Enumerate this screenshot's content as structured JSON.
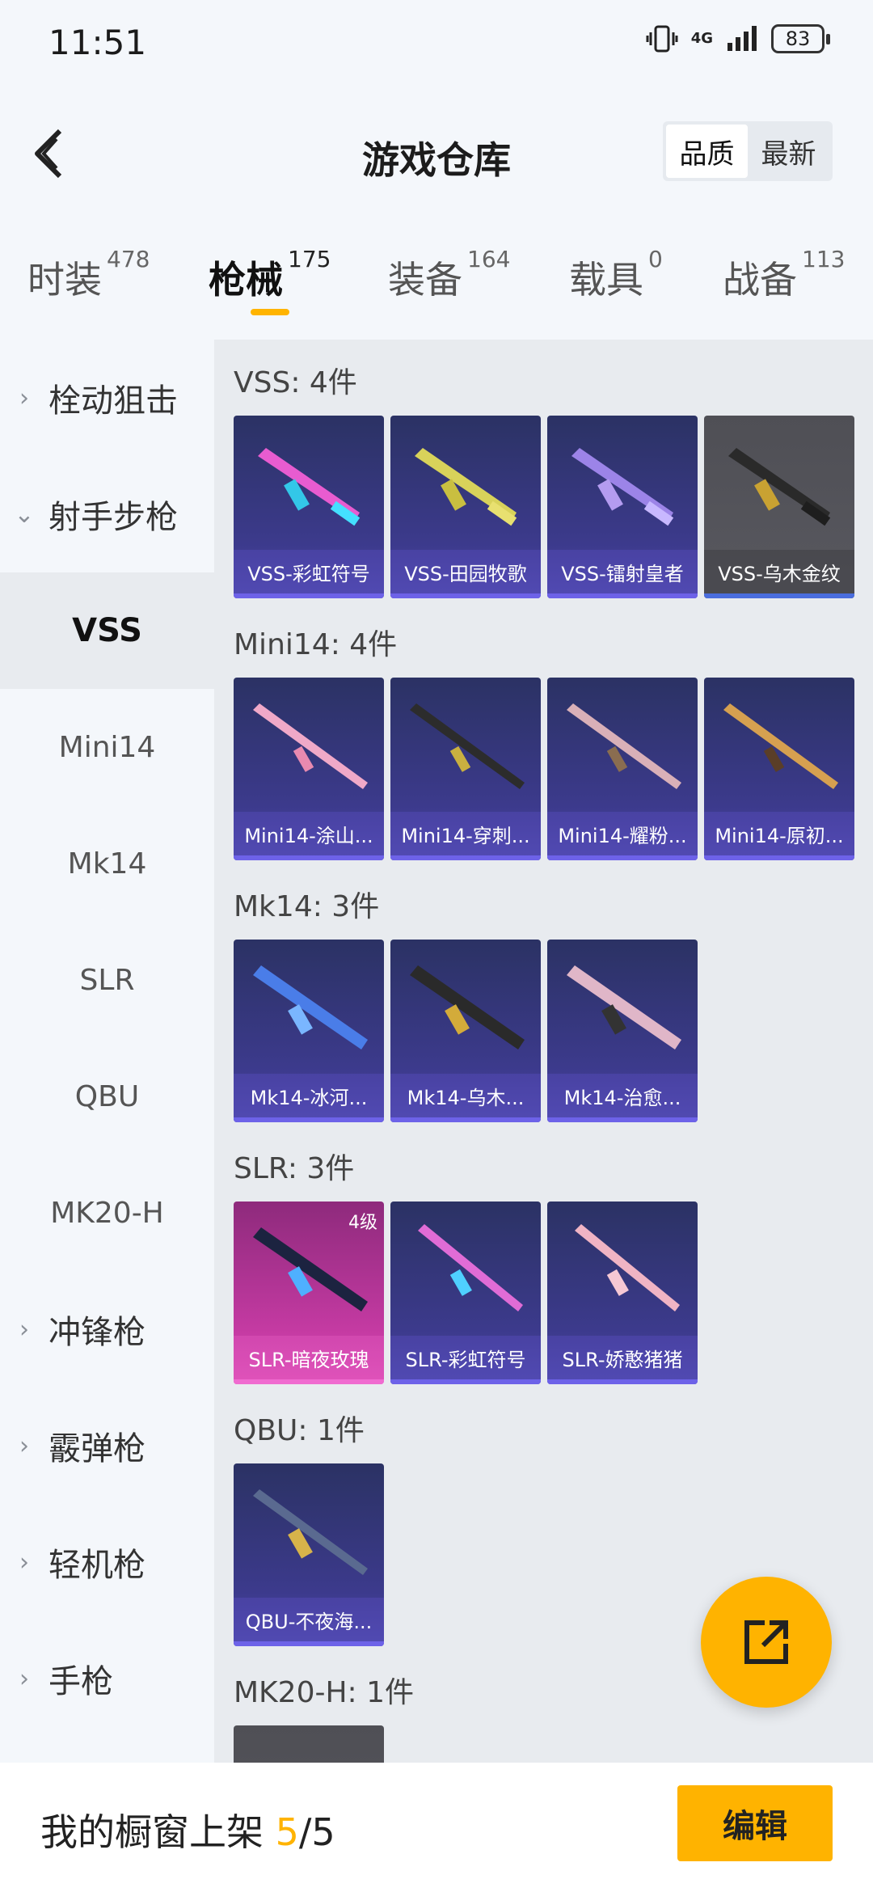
{
  "status_bar": {
    "time": "11:51",
    "network": "4G",
    "battery": "83"
  },
  "header": {
    "title": "游戏仓库",
    "sort": [
      "品质",
      "最新"
    ]
  },
  "tabs": [
    {
      "label": "时装",
      "count": "478"
    },
    {
      "label": "枪械",
      "count": "175"
    },
    {
      "label": "装备",
      "count": "164"
    },
    {
      "label": "载具",
      "count": "0"
    },
    {
      "label": "战备",
      "count": "113"
    }
  ],
  "sidebar": {
    "categories": [
      {
        "label": "栓动狙击"
      },
      {
        "label": "射手步枪"
      },
      {
        "label": "冲锋枪"
      },
      {
        "label": "霰弹枪"
      },
      {
        "label": "轻机枪"
      },
      {
        "label": "手枪"
      }
    ],
    "sub_items": [
      "VSS",
      "Mini14",
      "Mk14",
      "SLR",
      "QBU",
      "MK20-H"
    ]
  },
  "sections": [
    {
      "title": "VSS: 4件",
      "items": [
        "VSS-彩虹符号",
        "VSS-田园牧歌",
        "VSS-镭射皇者",
        "VSS-乌木金纹"
      ]
    },
    {
      "title": "Mini14: 4件",
      "items": [
        "Mini14-涂山...",
        "Mini14-穿刺...",
        "Mini14-耀粉...",
        "Mini14-原初..."
      ]
    },
    {
      "title": "Mk14: 3件",
      "items": [
        "Mk14-冰河...",
        "Mk14-乌木...",
        "Mk14-治愈..."
      ]
    },
    {
      "title": "SLR: 3件",
      "items": [
        "SLR-暗夜玫瑰",
        "SLR-彩虹符号",
        "SLR-娇憨猪猪"
      ],
      "level": "4级"
    },
    {
      "title": "QBU: 1件",
      "items": [
        "QBU-不夜海..."
      ]
    },
    {
      "title": "MK20-H: 1件"
    }
  ],
  "bottom": {
    "text": "我的橱窗上架",
    "count": "5",
    "total": "/5",
    "edit_label": "编辑"
  },
  "colors": {
    "accent": "#ffb300"
  }
}
